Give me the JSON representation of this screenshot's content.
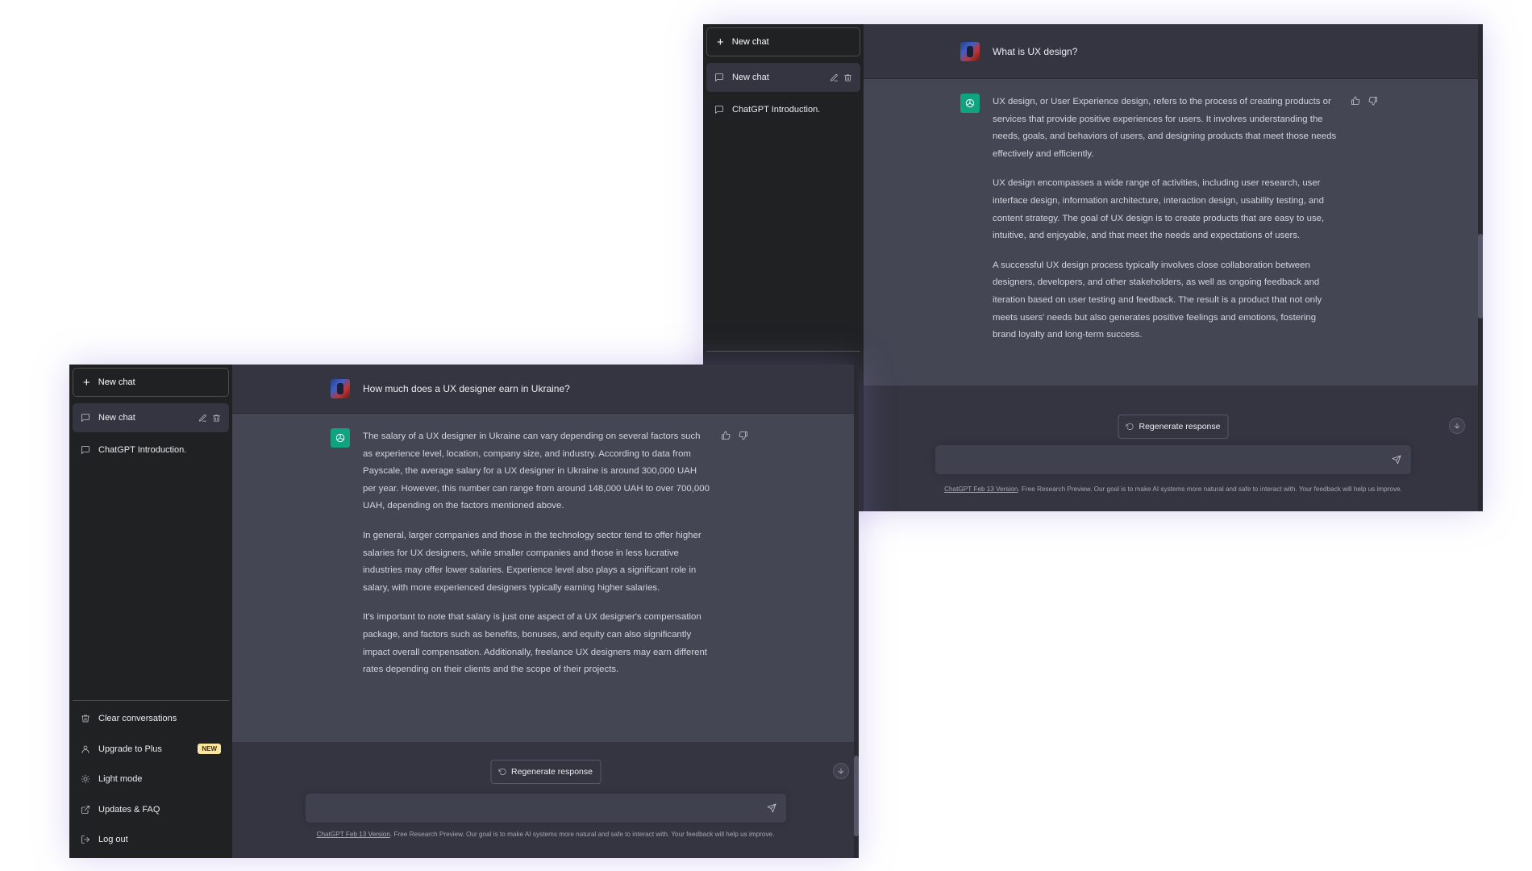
{
  "back_window": {
    "sidebar": {
      "new_chat_label": "New chat",
      "conversations": [
        {
          "label": "New chat",
          "active": true
        },
        {
          "label": "ChatGPT Introduction.",
          "active": false
        }
      ]
    },
    "user_message": "What is UX design?",
    "answer": [
      "UX design, or User Experience design, refers to the process of creating products or services that provide positive experiences for users. It involves understanding the needs, goals, and behaviors of users, and designing products that meet those needs effectively and efficiently.",
      "UX design encompasses a wide range of activities, including user research, user interface design, information architecture, interaction design, usability testing, and content strategy. The goal of UX design is to create products that are easy to use, intuitive, and enjoyable, and that meet the needs and expectations of users.",
      "A successful UX design process typically involves close collaboration between designers, developers, and other stakeholders, as well as ongoing feedback and iteration based on user testing and feedback. The result is a product that not only meets users' needs but also generates positive feelings and emotions, fostering brand loyalty and long-term success."
    ],
    "regenerate_label": "Regenerate response",
    "input_placeholder": "",
    "footer_link": "ChatGPT Feb 13 Version",
    "footer_text": ". Free Research Preview. Our goal is to make AI systems more natural and safe to interact with. Your feedback will help us improve."
  },
  "front_window": {
    "sidebar": {
      "new_chat_label": "New chat",
      "conversations": [
        {
          "label": "New chat",
          "active": true
        },
        {
          "label": "ChatGPT Introduction.",
          "active": false
        }
      ],
      "bottom_items": [
        {
          "label": "Clear conversations",
          "icon": "trash-icon"
        },
        {
          "label": "Upgrade to Plus",
          "icon": "user-icon",
          "badge": "NEW"
        },
        {
          "label": "Light mode",
          "icon": "sun-icon"
        },
        {
          "label": "Updates & FAQ",
          "icon": "external-link-icon"
        },
        {
          "label": "Log out",
          "icon": "logout-icon"
        }
      ]
    },
    "user_message": "How much does a UX designer earn in Ukraine?",
    "answer": [
      "The salary of a UX designer in Ukraine can vary depending on several factors such as experience level, location, company size, and industry. According to data from Payscale, the average salary for a UX designer in Ukraine is around 300,000 UAH per year. However, this number can range from around 148,000 UAH to over 700,000 UAH, depending on the factors mentioned above.",
      "In general, larger companies and those in the technology sector tend to offer higher salaries for UX designers, while smaller companies and those in less lucrative industries may offer lower salaries. Experience level also plays a significant role in salary, with more experienced designers typically earning higher salaries.",
      "It's important to note that salary is just one aspect of a UX designer's compensation package, and factors such as benefits, bonuses, and equity can also significantly impact overall compensation. Additionally, freelance UX designers may earn different rates depending on their clients and the scope of their projects."
    ],
    "regenerate_label": "Regenerate response",
    "input_placeholder": "",
    "footer_link": "ChatGPT Feb 13 Version",
    "footer_text": ". Free Research Preview. Our goal is to make AI systems more natural and safe to interact with. Your feedback will help us improve."
  },
  "colors": {
    "sidebar_bg": "#202123",
    "main_bg": "#343541",
    "answer_bg": "#444654",
    "gpt_green": "#10a37f",
    "badge_yellow": "#fae69e"
  }
}
